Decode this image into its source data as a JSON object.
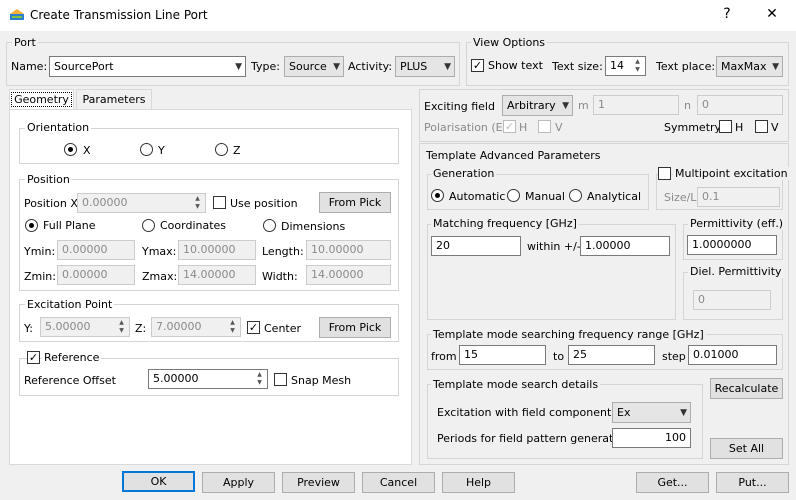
{
  "window": {
    "title": "Create Transmission Line Port",
    "help": "?",
    "close": "✕"
  },
  "port": {
    "group": "Port",
    "name_label": "Name:",
    "name_value": "SourcePort",
    "type_label": "Type:",
    "type_value": "Source",
    "activity_label": "Activity:",
    "activity_value": "PLUS"
  },
  "view": {
    "group": "View Options",
    "show_text": "Show text",
    "text_size_label": "Text size:",
    "text_size_value": "14",
    "text_place_label": "Text place:",
    "text_place_value": "MaxMax"
  },
  "tabs": {
    "geometry": "Geometry",
    "parameters": "Parameters"
  },
  "orientation": {
    "group": "Orientation",
    "x": "X",
    "y": "Y",
    "z": "Z"
  },
  "position": {
    "group": "Position",
    "posx_label": "Position X",
    "posx_value": "0.00000",
    "use_position": "Use position",
    "from_pick": "From Pick",
    "full_plane": "Full Plane",
    "coordinates": "Coordinates",
    "dimensions": "Dimensions",
    "ymin_label": "Ymin:",
    "ymin_value": "0.00000",
    "ymax_label": "Ymax:",
    "ymax_value": "10.00000",
    "length_label": "Length:",
    "length_value": "10.00000",
    "zmin_label": "Zmin:",
    "zmin_value": "0.00000",
    "zmax_label": "Zmax:",
    "zmax_value": "14.00000",
    "width_label": "Width:",
    "width_value": "14.00000"
  },
  "excitation": {
    "group": "Excitation Point",
    "y_label": "Y:",
    "y_value": "5.00000",
    "z_label": "Z:",
    "z_value": "7.00000",
    "center": "Center",
    "from_pick": "From Pick"
  },
  "reference": {
    "label": "Reference",
    "offset_label": "Reference Offset",
    "offset_value": "5.00000",
    "snap_mesh": "Snap Mesh"
  },
  "exciting": {
    "label": "Exciting field",
    "value": "Arbitrary",
    "m_label": "m",
    "m_value": "1",
    "n_label": "n",
    "n_value": "0",
    "polarisation_label": "Polarisation (E)",
    "h": "H",
    "v": "V",
    "symmetry_label": "Symmetry",
    "sym_h": "H",
    "sym_v": "V"
  },
  "template": {
    "group": "Template Advanced Parameters",
    "generation_group": "Generation",
    "automatic": "Automatic",
    "manual": "Manual",
    "analytical": "Analytical",
    "multipoint": "Multipoint excitation",
    "sizel_label": "Size/L",
    "sizel_value": "0.1",
    "matching_group": "Matching frequency [GHz]",
    "matching_value": "20",
    "within_label": "within +/-",
    "within_value": "1.00000",
    "permittivity_group": "Permittivity (eff.)",
    "permittivity_value": "1.0000000",
    "diel_group": "Diel. Permittivity",
    "diel_value": "0"
  },
  "range": {
    "group": "Template mode searching frequency range [GHz]",
    "from_label": "from",
    "from_value": "15",
    "to_label": "to",
    "to_value": "25",
    "step_label": "step",
    "step_value": "0.01000"
  },
  "search": {
    "group": "Template mode search details",
    "component_label": "Excitation with field component",
    "component_value": "Ex",
    "periods_label": "Periods for field pattern generation",
    "periods_value": "100",
    "recalculate": "Recalculate",
    "set_all": "Set All"
  },
  "footer": {
    "ok": "OK",
    "apply": "Apply",
    "preview": "Preview",
    "cancel": "Cancel",
    "help": "Help",
    "get": "Get...",
    "put": "Put..."
  }
}
